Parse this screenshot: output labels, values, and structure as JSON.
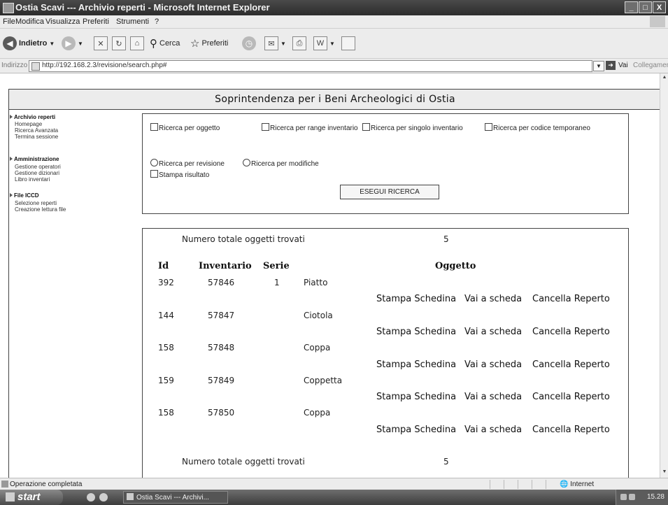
{
  "window": {
    "title": "Ostia Scavi --- Archivio reperti - Microsoft Internet Explorer",
    "min": "_",
    "max": "□",
    "close": "X"
  },
  "menu": [
    "File",
    "Modifica",
    "Visualizza",
    "Preferiti",
    "Strumenti",
    "?"
  ],
  "toolbar": {
    "back": "Indietro",
    "search": "Cerca",
    "favorites": "Preferiti"
  },
  "address": {
    "label": "Indirizzo",
    "url": "http://192.168.2.3/revisione/search.php#",
    "go": "Vai",
    "links": "Collegamenti"
  },
  "page": {
    "header": "Soprintendenza per i Beni Archeologici di Ostia"
  },
  "sidebar": {
    "sections": [
      {
        "title": "Archivio reperti",
        "items": [
          "Homepage",
          "Ricerca Avanzata",
          "Termina sessione"
        ]
      },
      {
        "title": "Amministrazione",
        "items": [
          "Gestione operatori",
          "Gestione dizionari",
          "Libro inventari"
        ]
      },
      {
        "title": "File ICCD",
        "items": [
          "Selezione reperti",
          "Creazione lettura file"
        ]
      }
    ]
  },
  "search": {
    "checkboxes": [
      "Ricerca per oggetto",
      "Ricerca per range inventario",
      "Ricerca per singolo inventario",
      "Ricerca per codice temporaneo"
    ],
    "radios": [
      "Ricerca per revisione",
      "Ricerca per modifiche"
    ],
    "print_checkbox": "Stampa risultato",
    "submit": "ESEGUI RICERCA"
  },
  "results": {
    "total_label": "Numero totale oggetti trovati",
    "total_value": "5",
    "columns": [
      "Id",
      "Inventario",
      "Serie",
      "Oggetto"
    ],
    "rows": [
      {
        "id": "392",
        "inventario": "57846",
        "serie": "1",
        "oggetto": "Piatto"
      },
      {
        "id": "144",
        "inventario": "57847",
        "serie": "",
        "oggetto": "Ciotola"
      },
      {
        "id": "158",
        "inventario": "57848",
        "serie": "",
        "oggetto": "Coppa"
      },
      {
        "id": "159",
        "inventario": "57849",
        "serie": "",
        "oggetto": "Coppetta"
      },
      {
        "id": "158",
        "inventario": "57850",
        "serie": "",
        "oggetto": "Coppa"
      }
    ],
    "actions": [
      "Stampa Schedina",
      "Vai a scheda",
      "Cancella Reperto"
    ]
  },
  "status": {
    "text": "Operazione completata",
    "zone": "Internet"
  },
  "taskbar": {
    "start": "start",
    "task": "Ostia Scavi --- Archivi...",
    "clock": "15.28"
  }
}
